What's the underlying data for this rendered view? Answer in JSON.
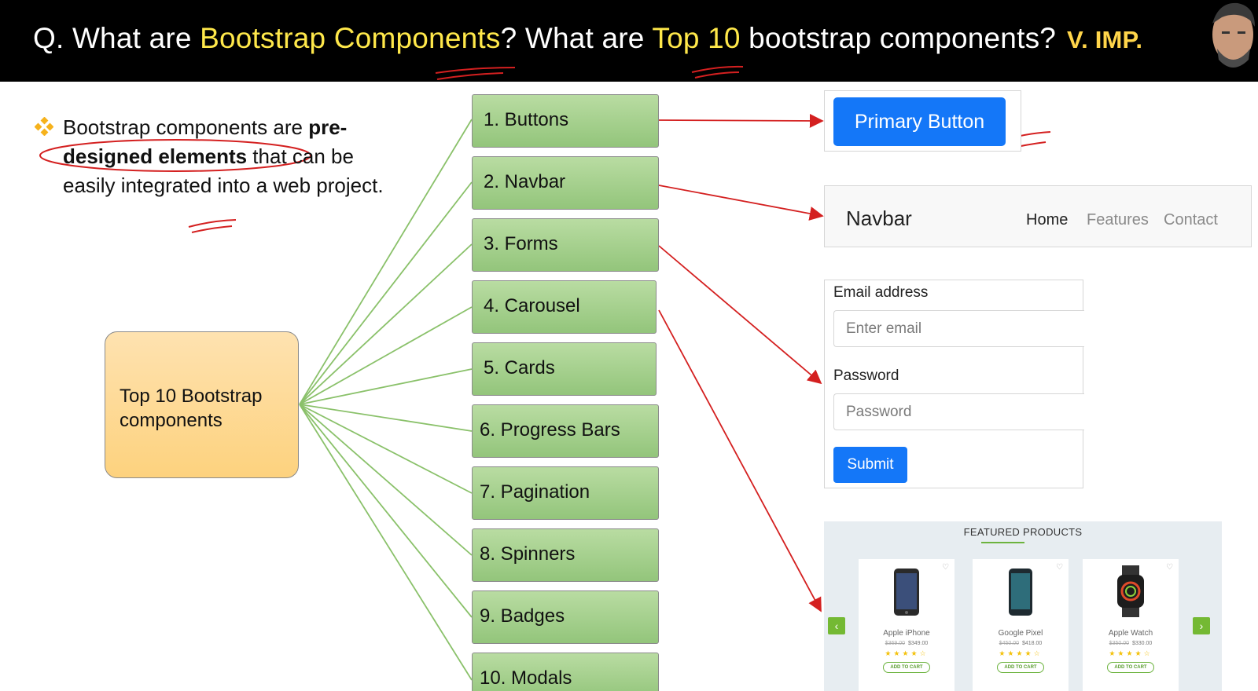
{
  "header": {
    "q_prefix": "Q. What are ",
    "q_hl1": "Bootstrap Components",
    "q_mid": "? What are ",
    "q_hl2": "Top 10",
    "q_suffix": " bootstrap components?",
    "badge": "V. IMP."
  },
  "bullet": {
    "intro": "Bootstrap components are ",
    "bold": "pre-designed elements",
    "rest": " that can be easily integrated into a web project."
  },
  "center": {
    "label": "Top 10 Bootstrap components"
  },
  "components": [
    "1. Buttons",
    "2. Navbar",
    "3. Forms",
    "4. Carousel",
    "5. Cards",
    "6. Progress Bars",
    "7. Pagination",
    "8. Spinners",
    "9. Badges",
    "10. Modals"
  ],
  "demo_button": {
    "label": "Primary Button"
  },
  "demo_navbar": {
    "brand": "Navbar",
    "links": [
      "Home",
      "Features",
      "Contact"
    ]
  },
  "demo_form": {
    "email_label": "Email address",
    "email_placeholder": "Enter email",
    "password_label": "Password",
    "password_placeholder": "Password",
    "submit": "Submit"
  },
  "demo_carousel": {
    "title": "FEATURED PRODUCTS",
    "prev": "‹",
    "next": "›",
    "products": [
      {
        "name": "Apple iPhone",
        "old_price": "$369.00",
        "price": "$349.00",
        "button": "ADD TO CART"
      },
      {
        "name": "Google Pixel",
        "old_price": "$450.00",
        "price": "$418.00",
        "button": "ADD TO CART"
      },
      {
        "name": "Apple Watch",
        "old_price": "$350.00",
        "price": "$330.00",
        "button": "ADD TO CART"
      }
    ],
    "stars": "★★★★☆"
  },
  "colors": {
    "highlight": "#ffe84a",
    "component_green": "#a7d18e",
    "center_orange": "#fdd27e",
    "arrow_red": "#d42020",
    "bootstrap_blue": "#1477f8"
  }
}
